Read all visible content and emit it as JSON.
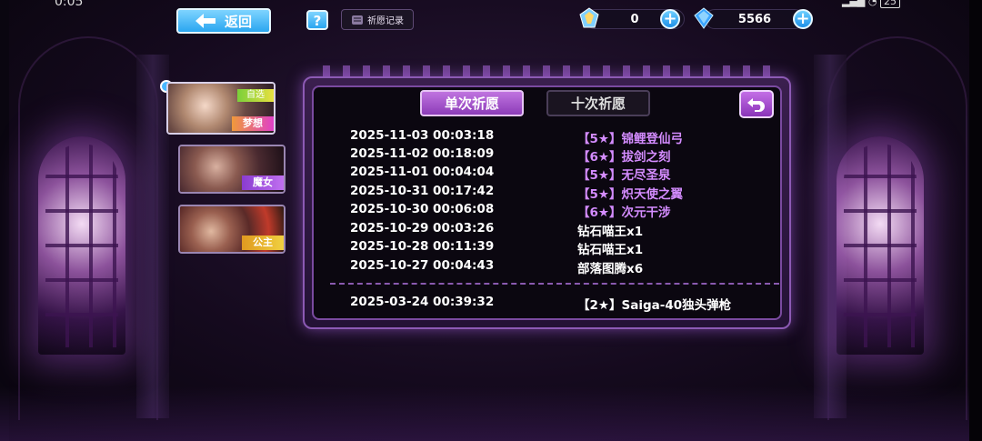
{
  "status": {
    "time": "0:05",
    "battery": "25"
  },
  "header": {
    "back_label": "返回",
    "help_label": "?",
    "record_label": "祈愿记录"
  },
  "currencies": [
    {
      "icon": "prism-crystal-icon",
      "value": "0"
    },
    {
      "icon": "blue-diamond-icon",
      "value": "5566"
    }
  ],
  "banners": [
    {
      "name": "梦想",
      "sub": "自选",
      "selected": true
    },
    {
      "name": "魔女"
    },
    {
      "name": "公主"
    }
  ],
  "tabs": {
    "single": "单次祈愿",
    "ten": "十次祈愿"
  },
  "records": [
    {
      "date": "2025-11-03 00:03:18",
      "item": "【5★】锦鲤登仙弓",
      "rare": true
    },
    {
      "date": "2025-11-02 00:18:09",
      "item": "【6★】拔剑之刻",
      "rare": true
    },
    {
      "date": "2025-11-01 00:04:04",
      "item": "【5★】无尽圣泉",
      "rare": true
    },
    {
      "date": "2025-10-31 00:17:42",
      "item": "【5★】炽天使之翼",
      "rare": true
    },
    {
      "date": "2025-10-30 00:06:08",
      "item": "【6★】次元干涉",
      "rare": true
    },
    {
      "date": "2025-10-29 00:03:26",
      "item": "钻石喵王x1",
      "rare": false
    },
    {
      "date": "2025-10-28 00:11:39",
      "item": "钻石喵王x1",
      "rare": false
    },
    {
      "date": "2025-10-27 00:04:43",
      "item": "部落图腾x6",
      "rare": false
    }
  ],
  "pinned_record": {
    "date": "2025-03-24 00:39:32",
    "item": "【2★】Saiga-40独头弹枪"
  },
  "colors": {
    "accent": "#b05ad8",
    "rare_text": "#d48cff",
    "button_blue": "#2aa6f0"
  }
}
